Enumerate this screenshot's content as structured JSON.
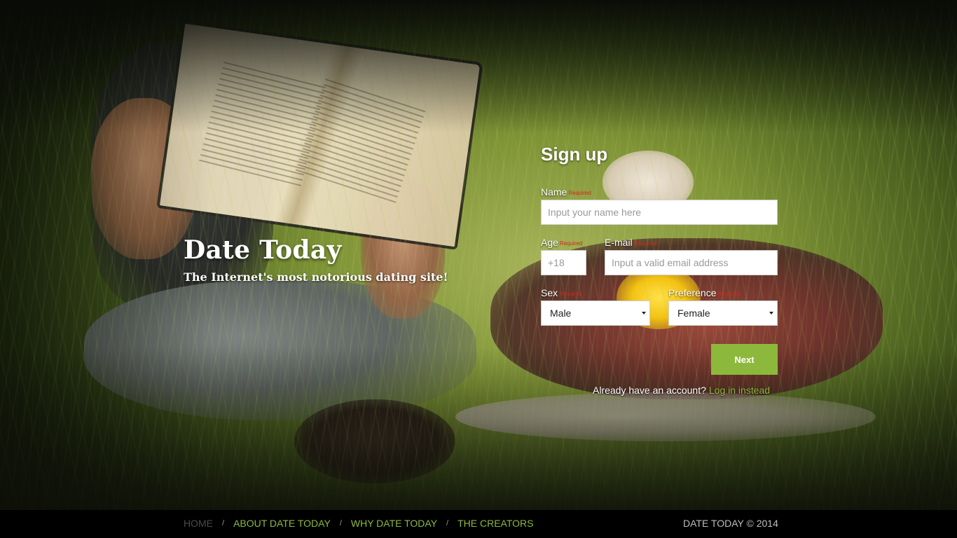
{
  "hero": {
    "title": "Date Today",
    "subtitle": "The Internet's most notorious dating site!"
  },
  "signup": {
    "title": "Sign up",
    "required_label": "Required",
    "name": {
      "label": "Name",
      "placeholder": "Input your name here"
    },
    "age": {
      "label": "Age",
      "placeholder": "+18"
    },
    "email": {
      "label": "E-mail",
      "placeholder": "Input a valid email address"
    },
    "sex": {
      "label": "Sex",
      "value": "Male"
    },
    "preference": {
      "label": "Preference",
      "value": "Female"
    },
    "next_label": "Next",
    "already_text": "Already have an account?",
    "login_text": "Log in instead"
  },
  "footer": {
    "nav": [
      {
        "label": "HOME",
        "active": true
      },
      {
        "label": "ABOUT DATE TODAY",
        "active": false
      },
      {
        "label": "WHY DATE TODAY",
        "active": false
      },
      {
        "label": "THE CREATORS",
        "active": false
      }
    ],
    "separator": "/",
    "copyright": "DATE TODAY © 2014"
  },
  "colors": {
    "accent": "#8cb93c",
    "footer_bg": "#000000",
    "required": "#d02a1e"
  }
}
